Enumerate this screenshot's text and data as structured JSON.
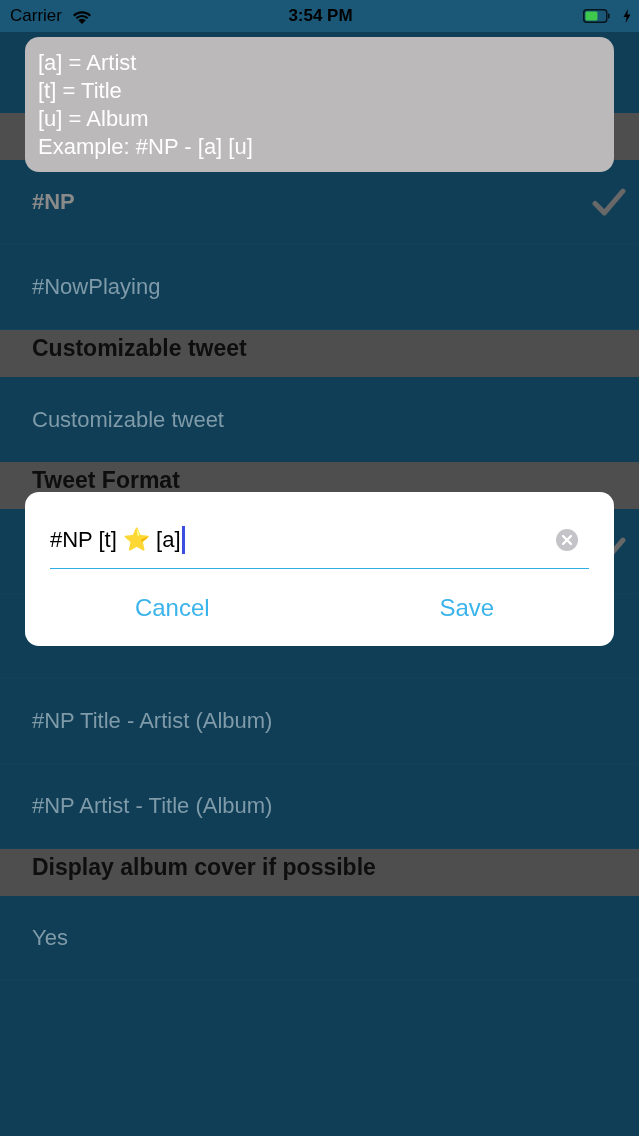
{
  "status_bar": {
    "carrier": "Carrier",
    "time": "3:54 PM"
  },
  "tooltip": {
    "lines": [
      "[a] = Artist",
      "[t] = Title",
      "[u] = Album",
      "Example: #NP - [a] [u]"
    ]
  },
  "sections": [
    {
      "kind": "options",
      "options": [
        {
          "label": "#NP",
          "checked": true
        },
        {
          "label": "#NowPlaying",
          "checked": false
        }
      ]
    },
    {
      "kind": "field",
      "title": "Customizable tweet",
      "placeholder": "Customizable tweet"
    },
    {
      "kind": "options",
      "title": "Tweet Format",
      "options": [
        {
          "checked": true
        },
        {
          "checked": false
        },
        {
          "label": "#NP Title - Artist (Album)",
          "checked": false
        },
        {
          "label": "#NP Artist - Title (Album)",
          "checked": false
        }
      ]
    },
    {
      "kind": "options",
      "title": "Display album cover if possible",
      "options": [
        {
          "label": "Yes",
          "checked": false
        }
      ]
    }
  ],
  "dialog": {
    "value": "#NP [t] ⭐ [a]",
    "buttons": [
      {
        "label": "Cancel"
      },
      {
        "label": "Save"
      }
    ]
  }
}
